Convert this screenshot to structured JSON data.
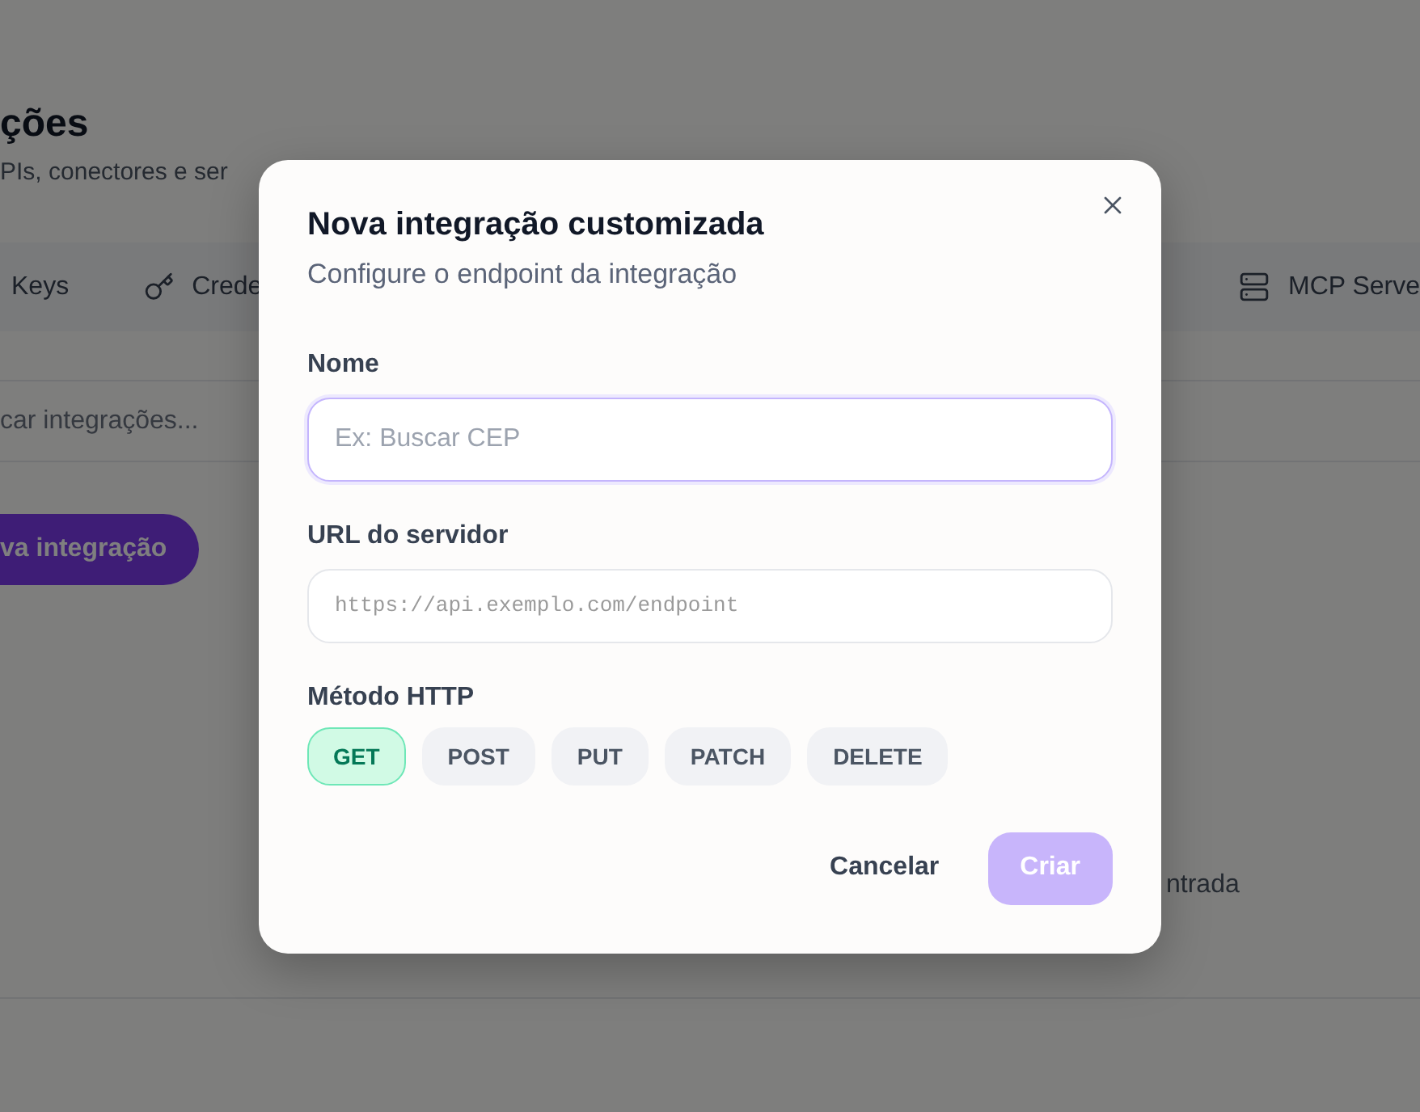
{
  "background_page": {
    "title": "ções",
    "subtitle": "PIs, conectores e ser",
    "tabs": [
      {
        "label": "Keys",
        "selected": false
      },
      {
        "label": "Crede",
        "selected": false
      },
      {
        "label": "MCP Serve",
        "selected": false
      }
    ],
    "search": {
      "placeholder": "car integrações..."
    },
    "new_button": {
      "label": "va integração"
    },
    "empty_state": "ntrada"
  },
  "dialog": {
    "title": "Nova integração customizada",
    "subtitle": "Configure o endpoint da integração",
    "fields": [
      {
        "label": "Nome",
        "placeholder": "Ex: Buscar CEP",
        "kind": "text",
        "focused": true
      },
      {
        "label": "URL do servidor",
        "placeholder": "https://api.exemplo.com/endpoint",
        "kind": "url",
        "focused": false
      }
    ],
    "method": {
      "label": "Método HTTP",
      "options": [
        {
          "label": "GET",
          "selected": true
        },
        {
          "label": "POST",
          "selected": false
        },
        {
          "label": "PUT",
          "selected": false
        },
        {
          "label": "PATCH",
          "selected": false
        },
        {
          "label": "DELETE",
          "selected": false
        }
      ]
    },
    "buttons": [
      {
        "label": "Cancelar",
        "kind": "secondary",
        "disabled": false
      },
      {
        "label": "Criar",
        "kind": "primary",
        "disabled": true
      }
    ]
  }
}
